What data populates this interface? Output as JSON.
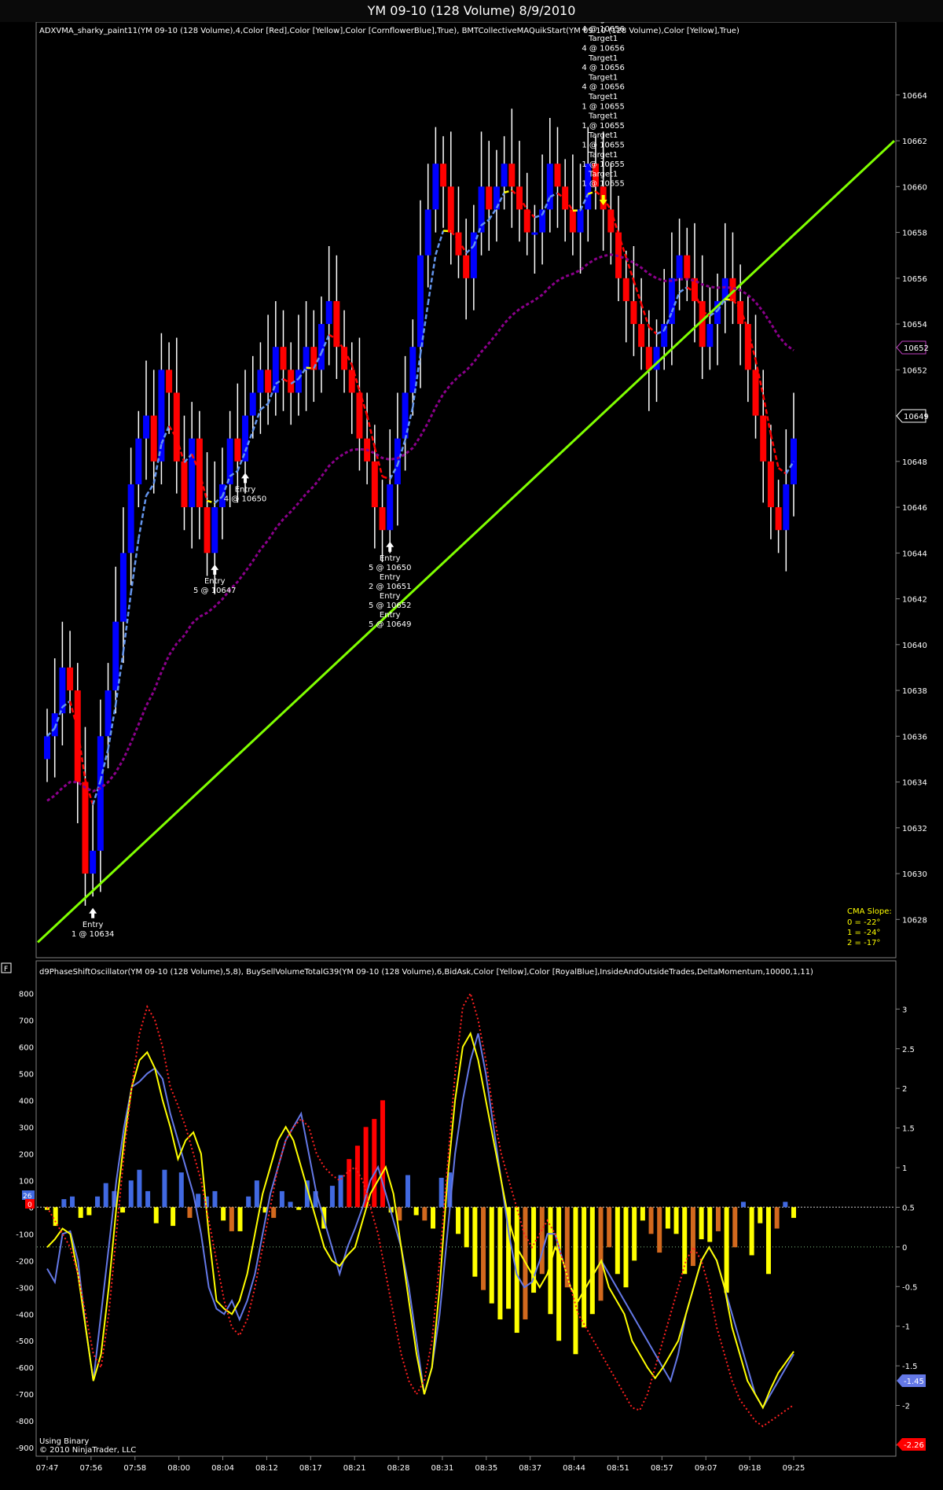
{
  "window_title": "YM 09-10 (128 Volume)  8/9/2010",
  "price_panel": {
    "indicator_label": "ADXVMA_sharky_paint11(YM 09-10 (128 Volume),4,Color [Red],Color [Yellow],Color [CornflowerBlue],True), BMTCollectiveMAQuikStart(YM 09-10 (128 Volume),Color [Yellow],True)",
    "price_marker_1": "10652",
    "price_marker_2": "10649",
    "cma_title": "CMA Slope:",
    "cma_lines": [
      "0 = -22°",
      "1 = -24°",
      "2 = -17°"
    ]
  },
  "osc_panel": {
    "indicator_label": "d9PhaseShiftOscillator(YM 09-10 (128 Volume),5,8), BuySellVolumeTotalG39(YM 09-10 (128 Volume),6,BidAsk,Color [Yellow],Color [RoyalBlue],InsideAndOutsideTrades,DeltaMomentum,10000,1,11)",
    "panel_flag": "F",
    "left_marker_1": "26",
    "left_marker_2": "0",
    "right_marker_1": "-1.45",
    "right_marker_2": "-2.26",
    "footer_1": "Using Binary",
    "footer_2": "© 2010 NinjaTrader, LLC"
  },
  "colors": {
    "up_bar": "#0000ff",
    "down_bar": "#ff0000",
    "wick": "#ffffff",
    "trend_line": "#80ff00",
    "adx_blue": "#6495ed",
    "adx_red": "#ff0000",
    "adx_yellow": "#ffff00",
    "cma": "#8b008b",
    "osc_blue": "#6478e6",
    "osc_yellow": "#ffff00",
    "osc_red_dotted": "#ff2020",
    "vol_blue": "#4169e1",
    "vol_red": "#ff0000",
    "vol_yellow": "#ffff00",
    "vol_orange": "#d2691e"
  },
  "chart_data": [
    {
      "type": "candlestick",
      "title": "YM 09-10 (128 Volume)  8/9/2010",
      "y_axis": {
        "side": "right",
        "ylim": [
          10626.5,
          10666.5
        ],
        "ticks": [
          10628,
          10630,
          10632,
          10634,
          10636,
          10638,
          10640,
          10642,
          10644,
          10646,
          10648,
          10650,
          10652,
          10654,
          10656,
          10658,
          10660,
          10662,
          10664
        ]
      },
      "x_axis": {
        "ticks": [
          "07:47",
          "07:56",
          "07:58",
          "08:00",
          "08:04",
          "08:12",
          "08:17",
          "08:21",
          "08:28",
          "08:31",
          "08:35",
          "08:37",
          "08:44",
          "08:51",
          "08:57",
          "09:07",
          "09:18",
          "09:25"
        ]
      },
      "closes": [
        10636,
        10637,
        10639,
        10638,
        10634,
        10630,
        10631,
        10636,
        10638,
        10641,
        10644,
        10647,
        10649,
        10650,
        10648,
        10652,
        10651,
        10648,
        10646,
        10649,
        10646,
        10644,
        10646,
        10647,
        10649,
        10648,
        10650,
        10651,
        10652,
        10651,
        10653,
        10652,
        10651,
        10652,
        10653,
        10652,
        10654,
        10655,
        10653,
        10652,
        10651,
        10649,
        10648,
        10646,
        10645,
        10647,
        10649,
        10651,
        10653,
        10657,
        10659,
        10661,
        10660,
        10658,
        10657,
        10656,
        10658,
        10660,
        10659,
        10660,
        10661,
        10660,
        10659,
        10658,
        10658,
        10659,
        10661,
        10660,
        10659,
        10658,
        10659,
        10661,
        10660,
        10659,
        10658,
        10656,
        10655,
        10654,
        10653,
        10652,
        10653,
        10654,
        10656,
        10657,
        10656,
        10655,
        10653,
        10654,
        10655,
        10656,
        10655,
        10654,
        10652,
        10650,
        10648,
        10646,
        10645,
        10647,
        10649
      ],
      "trend_line": {
        "from": [
          "07:47",
          10627
        ],
        "to": [
          "09:25+",
          10662
        ]
      },
      "annotations": [
        {
          "bar": 6,
          "side": "below",
          "text": [
            "Entry",
            "1 @ 10634"
          ]
        },
        {
          "bar": 22,
          "side": "below",
          "text": [
            "Entry",
            "5 @ 10647"
          ]
        },
        {
          "bar": 26,
          "side": "below",
          "text": [
            "Entry",
            "4 @ 10650"
          ]
        },
        {
          "bar": 45,
          "side": "below",
          "text": [
            "Entry",
            "5 @ 10650",
            "Entry",
            "2 @ 10651",
            "Entry",
            "5 @ 10652",
            "Entry",
            "5 @ 10649"
          ]
        },
        {
          "bar": 73,
          "side": "above",
          "text": [
            "Target1",
            "4 @ 10656",
            "Target1",
            "4 @ 10656",
            "Target1",
            "4 @ 10656",
            "Target1",
            "4 @ 10656",
            "Target1",
            "4 @ 10656",
            "Target1",
            "1 @ 10655",
            "Target1",
            "1 @ 10655",
            "Target1",
            "1 @ 10655",
            "Target1",
            "1 @ 10655",
            "Target1",
            "1 @ 10655"
          ]
        }
      ]
    },
    {
      "type": "line+bar",
      "left_axis": {
        "ylim": [
          -920,
          860
        ],
        "ticks": [
          -900,
          -800,
          -700,
          -600,
          -500,
          -400,
          -300,
          -200,
          -100,
          0,
          100,
          200,
          300,
          400,
          500,
          600,
          700,
          800
        ]
      },
      "right_axis": {
        "ylim": [
          -2.6,
          3.4
        ],
        "ticks": [
          -2.5,
          -2,
          -1.5,
          -1,
          -0.5,
          0,
          0.5,
          1,
          1.5,
          2,
          2.5,
          3
        ]
      },
      "series": [
        {
          "name": "d9PhaseShiftOscillator (blue)",
          "axis": "left",
          "values": [
            -230,
            -280,
            -100,
            -90,
            -200,
            -450,
            -650,
            -400,
            -150,
            100,
            300,
            450,
            470,
            500,
            520,
            480,
            350,
            250,
            150,
            50,
            -100,
            -300,
            -380,
            -400,
            -350,
            -420,
            -350,
            -250,
            -100,
            50,
            150,
            250,
            300,
            350,
            200,
            50,
            -50,
            -150,
            -250,
            -150,
            -80,
            0,
            100,
            150,
            50,
            -50,
            -150,
            -300,
            -500,
            -700,
            -600,
            -400,
            -100,
            200,
            400,
            550,
            650,
            500,
            300,
            100,
            -100,
            -250,
            -300,
            -280,
            -200,
            -100,
            -100,
            -200,
            -300,
            -350,
            -300,
            -250,
            -200,
            -250,
            -300,
            -350,
            -400,
            -450,
            -500,
            -550,
            -600,
            -650,
            -550,
            -400,
            -300,
            -200,
            -150,
            -200,
            -300,
            -400,
            -500,
            -600,
            -700,
            -750,
            -700,
            -650,
            -600,
            -550
          ]
        },
        {
          "name": "d9PhaseShiftOscillator (yellow)",
          "axis": "left",
          "values": [
            -150,
            -120,
            -80,
            -100,
            -250,
            -450,
            -650,
            -550,
            -300,
            0,
            250,
            450,
            550,
            580,
            520,
            400,
            300,
            180,
            250,
            280,
            200,
            -100,
            -350,
            -380,
            -400,
            -350,
            -250,
            -100,
            50,
            150,
            250,
            300,
            250,
            150,
            50,
            -50,
            -150,
            -200,
            -220,
            -180,
            -150,
            -50,
            50,
            100,
            150,
            50,
            -150,
            -350,
            -550,
            -700,
            -600,
            -300,
            100,
            400,
            600,
            650,
            550,
            400,
            250,
            100,
            -50,
            -150,
            -200,
            -250,
            -300,
            -250,
            -150,
            -200,
            -300,
            -350,
            -300,
            -250,
            -200,
            -300,
            -350,
            -400,
            -500,
            -550,
            -600,
            -640,
            -600,
            -550,
            -500,
            -400,
            -300,
            -200,
            -150,
            -200,
            -300,
            -450,
            -550,
            -650,
            -700,
            -750,
            -680,
            -620,
            -580,
            -540
          ]
        },
        {
          "name": "d9PhaseShiftOscillator (red dotted)",
          "axis": "left",
          "values": [
            0,
            -50,
            -100,
            -150,
            -250,
            -400,
            -550,
            -600,
            -400,
            -100,
            200,
            450,
            650,
            750,
            700,
            600,
            450,
            380,
            300,
            200,
            100,
            -50,
            -200,
            -350,
            -450,
            -480,
            -420,
            -300,
            -150,
            0,
            150,
            250,
            300,
            330,
            300,
            200,
            150,
            120,
            100,
            130,
            150,
            100,
            0,
            -100,
            -250,
            -400,
            -550,
            -650,
            -700,
            -650,
            -500,
            -200,
            150,
            500,
            750,
            800,
            700,
            550,
            350,
            200,
            100,
            0,
            -100,
            -150,
            -100,
            -50,
            -100,
            -200,
            -300,
            -400,
            -450,
            -500,
            -550,
            -600,
            -650,
            -700,
            -750,
            -760,
            -700,
            -600,
            -500,
            -400,
            -300,
            -200,
            -150,
            -200,
            -300,
            -450,
            -550,
            -650,
            -720,
            -760,
            -800,
            -820,
            -800,
            -780,
            -760,
            -740
          ]
        },
        {
          "name": "BuySellVolumeTotalG39",
          "axis": "left",
          "type": "bar",
          "values": [
            -10,
            -70,
            30,
            40,
            -40,
            -30,
            40,
            90,
            60,
            -20,
            100,
            140,
            60,
            -60,
            140,
            -70,
            130,
            -40,
            50,
            40,
            60,
            -50,
            -90,
            -90,
            40,
            100,
            -20,
            -40,
            60,
            20,
            -10,
            100,
            60,
            -80,
            80,
            120,
            180,
            230,
            300,
            330,
            400,
            -20,
            -50,
            120,
            -30,
            -50,
            -80,
            110,
            130,
            -100,
            -150,
            -260,
            -310,
            -360,
            -420,
            -380,
            -470,
            -420,
            -320,
            -250,
            -400,
            -500,
            -300,
            -550,
            -450,
            -400,
            -350,
            -150,
            -250,
            -300,
            -200,
            -50,
            -100,
            -170,
            -80,
            -100,
            -250,
            -220,
            -120,
            -130,
            -90,
            -320,
            -150,
            20,
            -180,
            -60,
            -250,
            -80,
            20,
            -40
          ]
        }
      ]
    }
  ]
}
